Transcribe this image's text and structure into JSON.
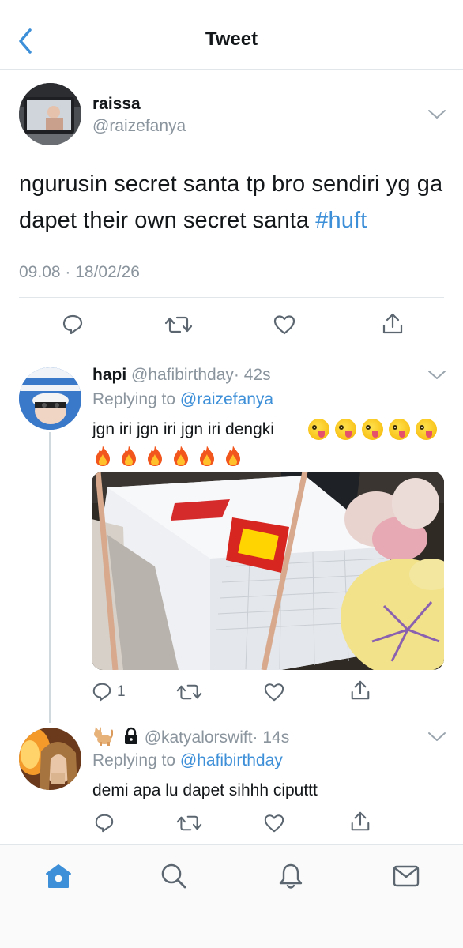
{
  "header": {
    "title": "Tweet",
    "back_icon": "chevron-left-icon"
  },
  "main_tweet": {
    "name": "raissa",
    "handle": "@raizefanya",
    "text": "ngurusin secret santa tp bro sendiri yg ga dapet their own secret santa ",
    "hashtag": "#huft",
    "timestamp": "09.08 · 18/02/26",
    "actions": [
      "reply-icon",
      "retweet-icon",
      "like-icon",
      "share-icon"
    ]
  },
  "replies": [
    {
      "name": "hapi",
      "handle": "@hafibirthday",
      "time": "· 42s",
      "replying_prefix": "Replying to ",
      "replying_to": "@raizefanya",
      "text": "jgn iri jgn iri jgn iri dengki",
      "emojis_line1": [
        "zany-face",
        "zany-face",
        "zany-face",
        "zany-face",
        "zany-face"
      ],
      "emojis_line2": [
        "fire",
        "fire",
        "fire",
        "fire",
        "fire",
        "fire"
      ],
      "reply_count": "1"
    },
    {
      "name_emojis": [
        "cat-emoji",
        "lock-icon"
      ],
      "handle": "@katyalorswift",
      "time": "· 14s",
      "replying_prefix": "Replying to ",
      "replying_to": "@hafibirthday",
      "text": "demi apa lu dapet sihhh ciputtt"
    }
  ],
  "colors": {
    "accent": "#3d8fd8",
    "secondary_text": "#8a949d",
    "primary_text": "#14171a"
  },
  "tabbar": [
    "home-icon",
    "search-icon",
    "notifications-icon",
    "messages-icon"
  ]
}
